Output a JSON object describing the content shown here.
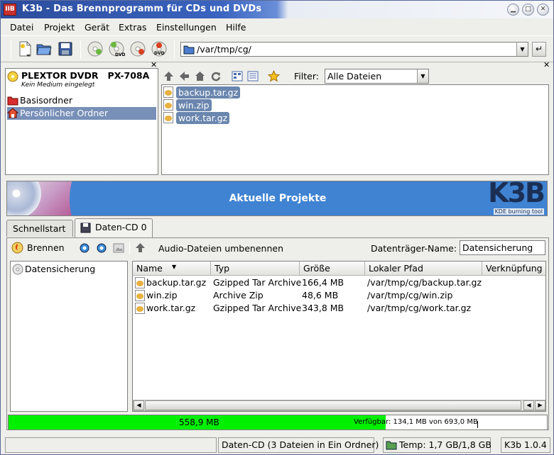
{
  "window": {
    "title": "K3b - Das Brennprogramm für CDs und DVDs",
    "app_icon_text": "IIB"
  },
  "menu": [
    "Datei",
    "Projekt",
    "Gerät",
    "Extras",
    "Einstellungen",
    "Hilfe"
  ],
  "toolbar": {
    "icons": [
      "new-project-icon",
      "open-icon",
      "save-icon",
      "audio-cd-icon",
      "dvd-icon",
      "data-cd-icon",
      "data-dvd-icon"
    ],
    "path": "/var/tmp/cg/"
  },
  "device_tree": {
    "device_name": "PLEXTOR DVDR   PX-708A",
    "device_status": "Kein Medium eingelegt",
    "items": [
      {
        "label": "Basisordner",
        "selected": false
      },
      {
        "label": "Persönlicher Ordner",
        "selected": true
      }
    ]
  },
  "file_browser": {
    "filter_label": "Filter:",
    "filter_value": "Alle Dateien",
    "files": [
      "backup.tar.gz",
      "win.zip",
      "work.tar.gz"
    ]
  },
  "banner": {
    "title": "Aktuelle Projekte",
    "logo": "K3B",
    "logo_sub": "KDE burning tool"
  },
  "tabs": [
    {
      "label": "Schnellstart",
      "active": false
    },
    {
      "label": "Daten-CD 0",
      "active": true
    }
  ],
  "project_toolbar": {
    "burn_label": "Brennen",
    "rename_label": "Audio-Dateien umbenennen",
    "volume_label": "Datenträger-Name:",
    "volume_value": "Datensicherung"
  },
  "project_tree": {
    "root": "Datensicherung"
  },
  "table": {
    "columns": [
      "Name",
      "Typ",
      "Größe",
      "Lokaler Pfad",
      "Verknüpfung"
    ],
    "rows": [
      [
        "backup.tar.gz",
        "Gzipped Tar Archive",
        "166,4 MB",
        "/var/tmp/cg/backup.tar.gz",
        ""
      ],
      [
        "win.zip",
        "Archive Zip",
        "48,6 MB",
        "/var/tmp/cg/win.zip",
        ""
      ],
      [
        "work.tar.gz",
        "Gzipped Tar Archive",
        "343,8 MB",
        "/var/tmp/cg/work.tar.gz",
        ""
      ]
    ]
  },
  "capacity": {
    "used": "558,9 MB",
    "available": "Verfügbar: 134,1 MB von 693,0 MB",
    "fill_fraction": 0.7
  },
  "statusbar": {
    "project": "Daten-CD (3 Dateien in Ein Ordner)",
    "temp": "Temp: 1,7 GB/1,8 GB",
    "version": "K3b 1.0.4"
  },
  "colors": {
    "selection": "#7890b8",
    "progress": "#00f000",
    "banner": "#3f83d2"
  }
}
